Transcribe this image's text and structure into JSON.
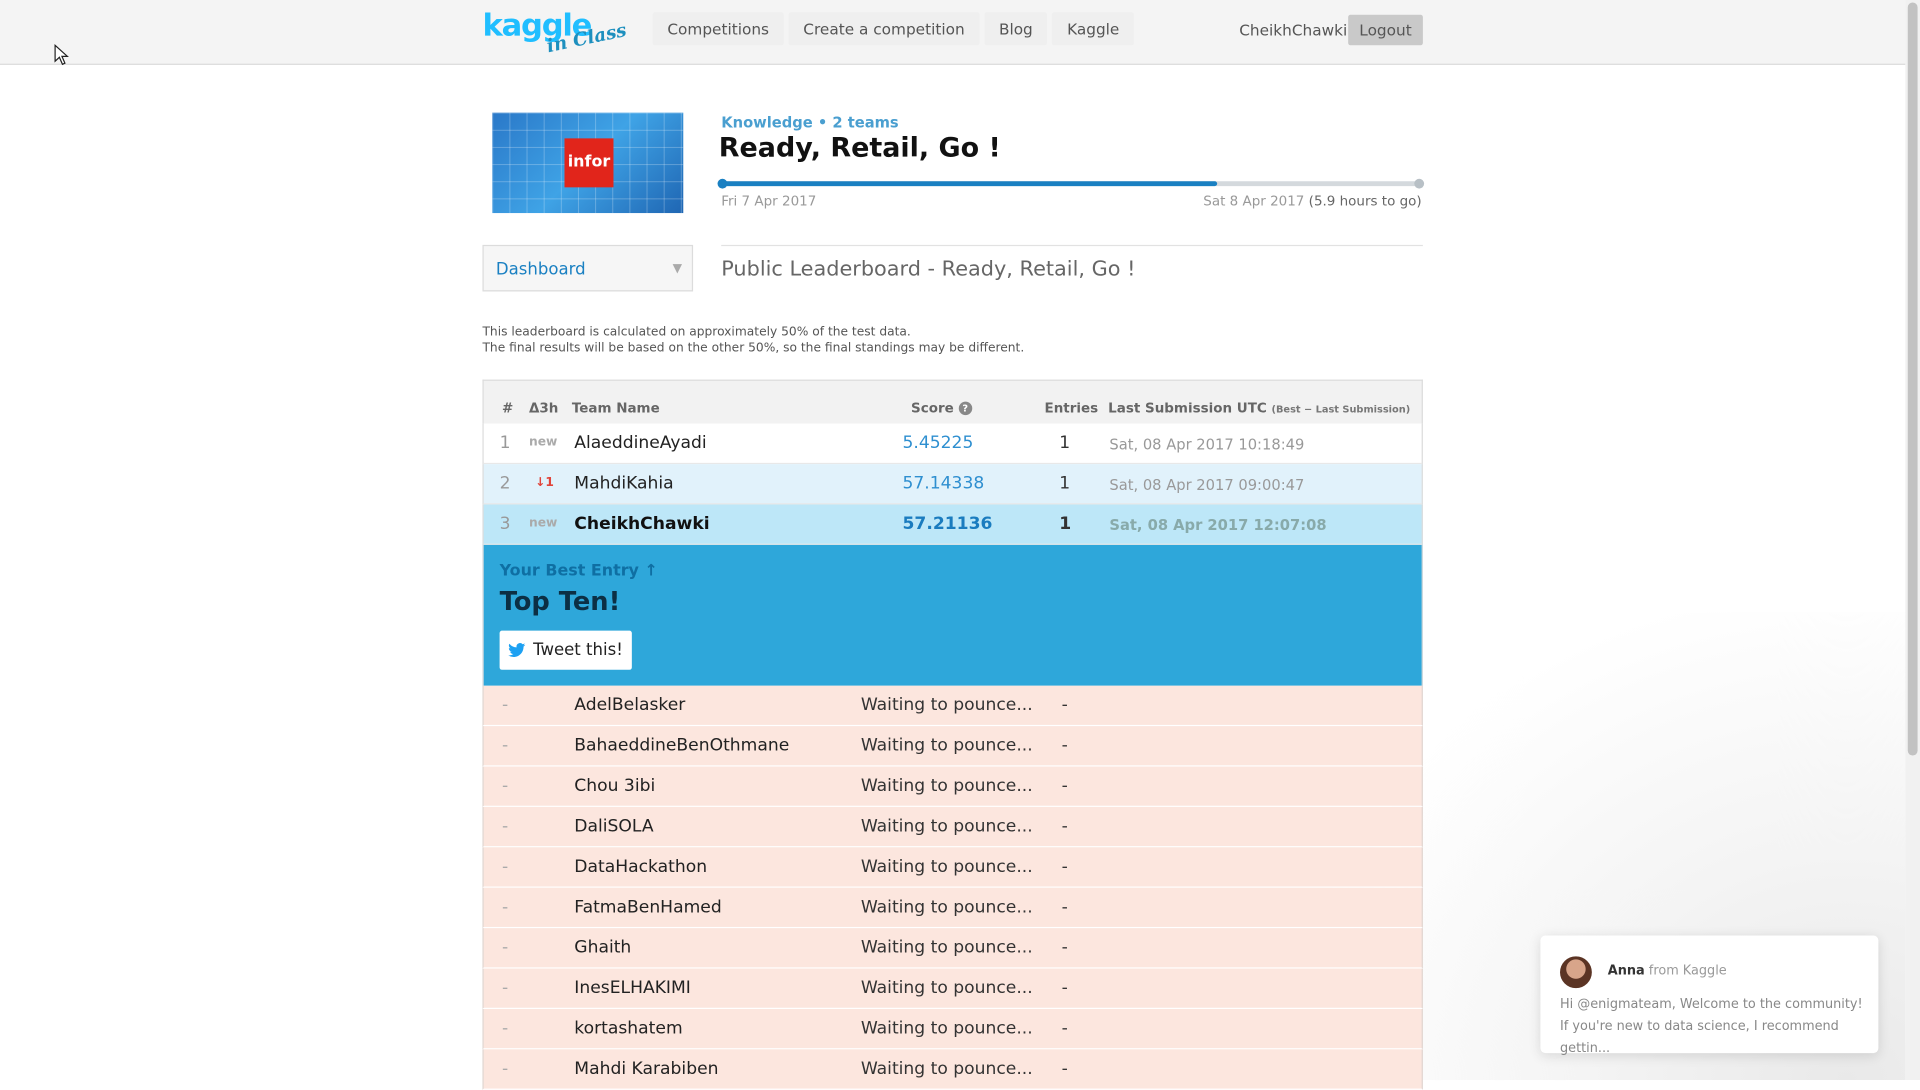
{
  "header": {
    "logo_main": "kaggle",
    "logo_sub": "in Class",
    "nav": [
      "Competitions",
      "Create a competition",
      "Blog",
      "Kaggle"
    ],
    "username": "CheikhChawki",
    "logout_label": "Logout"
  },
  "competition": {
    "thumbnail_text": "infor",
    "category": "Knowledge • 2 teams",
    "title": "Ready, Retail, Go !",
    "start_date": "Fri 7 Apr 2017",
    "end_date": "Sat 8 Apr 2017",
    "time_left": "(5.9 hours to go)",
    "progress": 0.71
  },
  "sidebar": {
    "dropdown_label": "Dashboard"
  },
  "leaderboard": {
    "title": "Public Leaderboard - Ready, Retail, Go !",
    "note_line1": "This leaderboard is calculated on approximately 50% of the test data.",
    "note_line2": "The final results will be based on the other 50%, so the final standings may be different.",
    "columns": {
      "rank": "#",
      "delta": "Δ3h",
      "team": "Team Name",
      "score": "Score",
      "entries": "Entries",
      "last": "Last Submission UTC",
      "last_sub": "(Best − Last Submission)"
    },
    "rows": [
      {
        "rank": "1",
        "delta": "new",
        "team": "AlaeddineAyadi",
        "score": "5.45225",
        "entries": "1",
        "last": "Sat, 08 Apr 2017 10:18:49"
      },
      {
        "rank": "2",
        "delta": "↓1",
        "team": "MahdiKahia",
        "score": "57.14338",
        "entries": "1",
        "last": "Sat, 08 Apr 2017 09:00:47"
      },
      {
        "rank": "3",
        "delta": "new",
        "team": "CheikhChawki",
        "score": "57.21136",
        "entries": "1",
        "last": "Sat, 08 Apr 2017 12:07:08"
      }
    ],
    "best_entry": {
      "kicker": "Your Best Entry ↑",
      "headline": "Top Ten!",
      "tweet_label": "Tweet this!"
    },
    "waiting": [
      {
        "rank": "-",
        "team": "AdelBelasker",
        "status": "Waiting to pounce...",
        "entries": "-"
      },
      {
        "rank": "-",
        "team": "BahaeddineBenOthmane",
        "status": "Waiting to pounce...",
        "entries": "-"
      },
      {
        "rank": "-",
        "team": "Chou 3ibi",
        "status": "Waiting to pounce...",
        "entries": "-"
      },
      {
        "rank": "-",
        "team": "DaliSOLA",
        "status": "Waiting to pounce...",
        "entries": "-"
      },
      {
        "rank": "-",
        "team": "DataHackathon",
        "status": "Waiting to pounce...",
        "entries": "-"
      },
      {
        "rank": "-",
        "team": "FatmaBenHamed",
        "status": "Waiting to pounce...",
        "entries": "-"
      },
      {
        "rank": "-",
        "team": "Ghaith",
        "status": "Waiting to pounce...",
        "entries": "-"
      },
      {
        "rank": "-",
        "team": "InesELHAKIMI",
        "status": "Waiting to pounce...",
        "entries": "-"
      },
      {
        "rank": "-",
        "team": "kortashatem",
        "status": "Waiting to pounce...",
        "entries": "-"
      },
      {
        "rank": "-",
        "team": "Mahdi Karabiben",
        "status": "Waiting to pounce...",
        "entries": "-"
      }
    ]
  },
  "chat": {
    "name": "Anna",
    "from": " from Kaggle",
    "message": "Hi @enigmateam, Welcome to the community! If you're new to data science, I recommend gettin..."
  },
  "colors": {
    "brand": "#20beff",
    "accent": "#1a80c2",
    "best_entry_bg": "#2ea7da",
    "waiting_bg": "#fce6de"
  }
}
